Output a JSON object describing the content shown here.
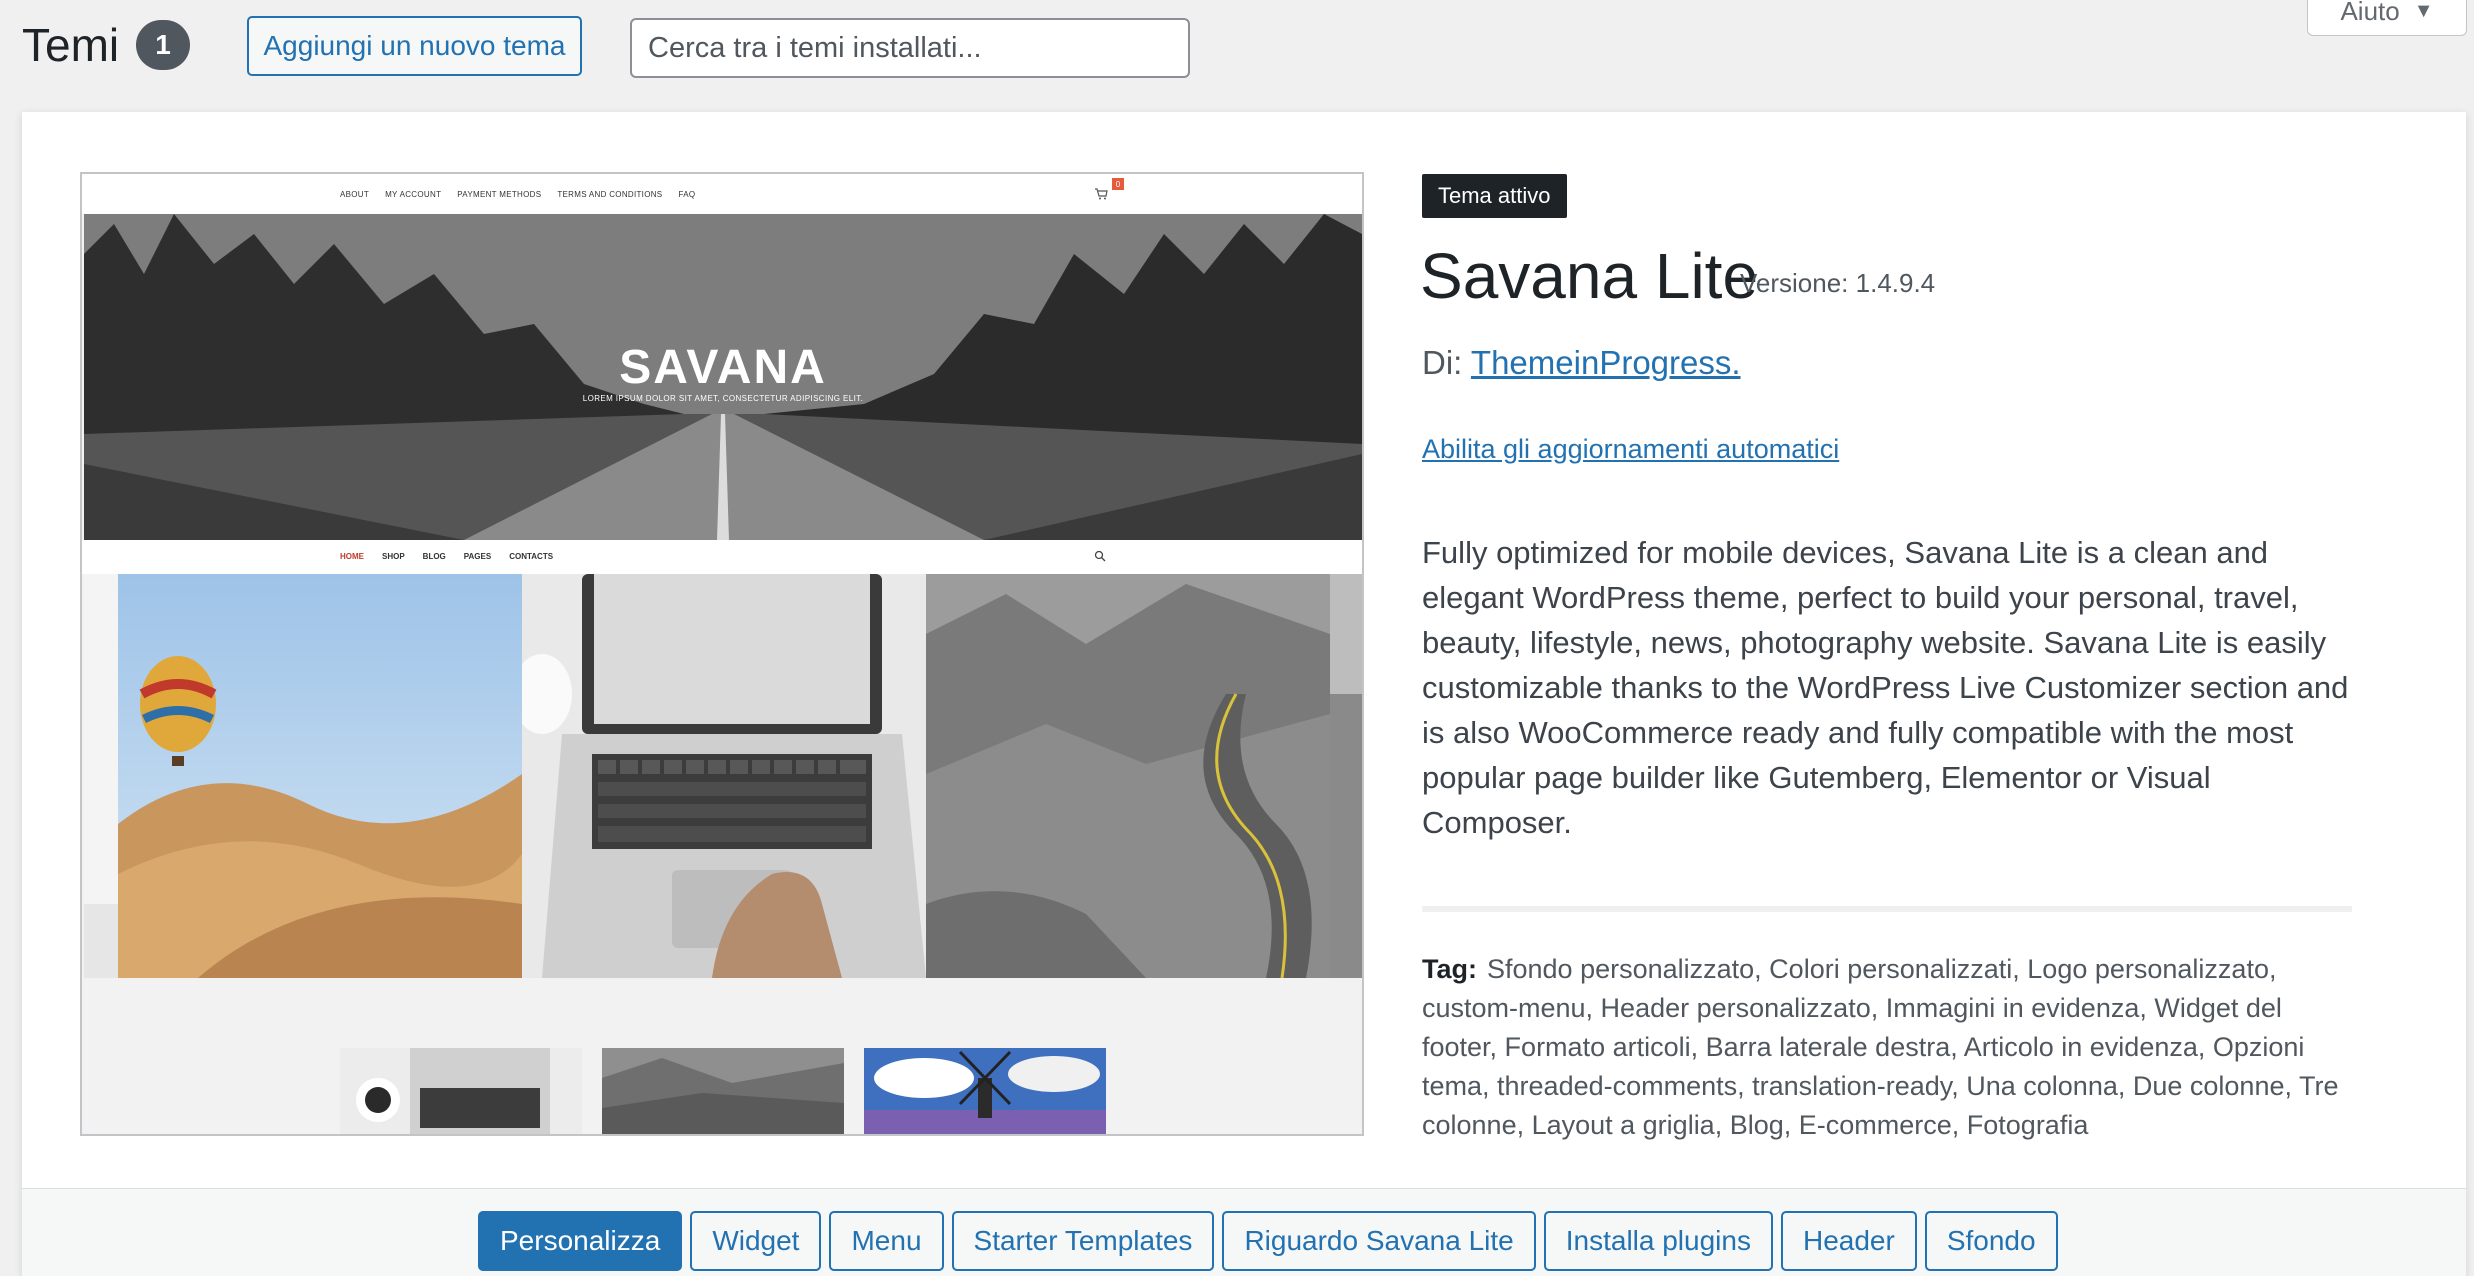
{
  "header": {
    "title": "Temi",
    "count": "1",
    "add_button": "Aggiungi un nuovo tema",
    "search_placeholder": "Cerca tra i temi installati...",
    "help": "Aiuto"
  },
  "screenshot": {
    "top_nav": [
      "ABOUT",
      "MY ACCOUNT",
      "PAYMENT METHODS",
      "TERMS AND CONDITIONS",
      "FAQ"
    ],
    "cart_count": "0",
    "hero_title": "SAVANA",
    "hero_subtitle": "LOREM IPSUM DOLOR SIT AMET, CONSECTETUR ADIPISCING ELIT.",
    "main_nav": [
      "HOME",
      "SHOP",
      "BLOG",
      "PAGES",
      "CONTACTS"
    ]
  },
  "theme": {
    "badge": "Tema attivo",
    "name": "Savana Lite",
    "version": "Versione: 1.4.9.4",
    "author_prefix": "Di:",
    "author": "ThemeinProgress.",
    "auto_update": "Abilita gli aggiornamenti automatici",
    "description": "Fully optimized for mobile devices, Savana Lite is a clean and elegant WordPress theme, perfect to build your personal, travel, beauty, lifestyle, news, photography website. Savana Lite is easily customizable thanks to the WordPress Live Customizer section and is also WooCommerce ready and fully compatible with the most popular page builder like Gutemberg, Elementor or Visual Composer.",
    "tags_label": "Tag:",
    "tags": "Sfondo personalizzato, Colori personalizzati, Logo personalizzato, custom-menu, Header personalizzato, Immagini in evidenza, Widget del footer, Formato articoli, Barra laterale destra, Articolo in evidenza, Opzioni tema, threaded-comments, translation-ready, Una colonna, Due colonne, Tre colonne, Layout a griglia, Blog, E-commerce, Fotografia"
  },
  "actions": [
    "Personalizza",
    "Widget",
    "Menu",
    "Starter Templates",
    "Riguardo Savana Lite",
    "Installa plugins",
    "Header",
    "Sfondo"
  ],
  "colors": {
    "accent": "#2271b1",
    "badge_bg": "#1d2327",
    "page_bg": "#f0f0f1"
  }
}
